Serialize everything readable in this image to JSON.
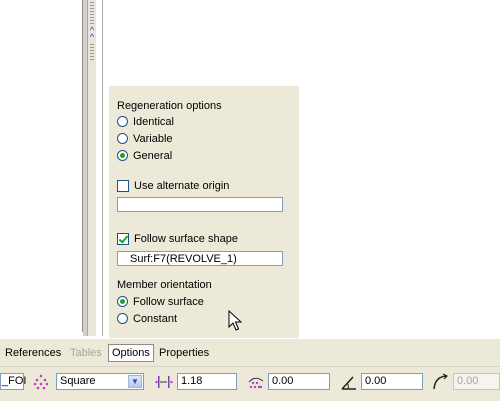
{
  "options_panel": {
    "regeneration": {
      "label": "Regeneration options",
      "options": [
        {
          "label": "Identical",
          "selected": false
        },
        {
          "label": "Variable",
          "selected": false
        },
        {
          "label": "General",
          "selected": true
        }
      ]
    },
    "alternate_origin": {
      "label": "Use alternate origin",
      "checked": false,
      "value": ""
    },
    "follow_surface": {
      "label": "Follow surface shape",
      "checked": true,
      "value": "Surf:F7(REVOLVE_1)"
    },
    "member_orientation": {
      "label": "Member orientation",
      "options": [
        {
          "label": "Follow surface",
          "selected": true
        },
        {
          "label": "Constant",
          "selected": false
        }
      ]
    }
  },
  "tabs": [
    {
      "label": "References",
      "state": "normal"
    },
    {
      "label": "Tables",
      "state": "disabled"
    },
    {
      "label": "Options",
      "state": "active"
    },
    {
      "label": "Properties",
      "state": "normal"
    }
  ],
  "toolbar": {
    "left_field_value": "_FOI",
    "pattern_type": {
      "value": "Square"
    },
    "spacing_value": "1.18",
    "offset_value": "0.00",
    "angle_value": "0.00",
    "radius_value": "0.00"
  },
  "icons": {
    "pattern_type": "pattern-type-icon",
    "spacing": "spacing-icon",
    "offset": "offset-icon",
    "angle": "angle-icon",
    "radius": "radius-icon",
    "cursor": "mouse-pointer-icon"
  },
  "colors": {
    "panel_bg": "#ece9d8",
    "radio_checked": "#21a121",
    "chevron": "#2b3cbf"
  }
}
